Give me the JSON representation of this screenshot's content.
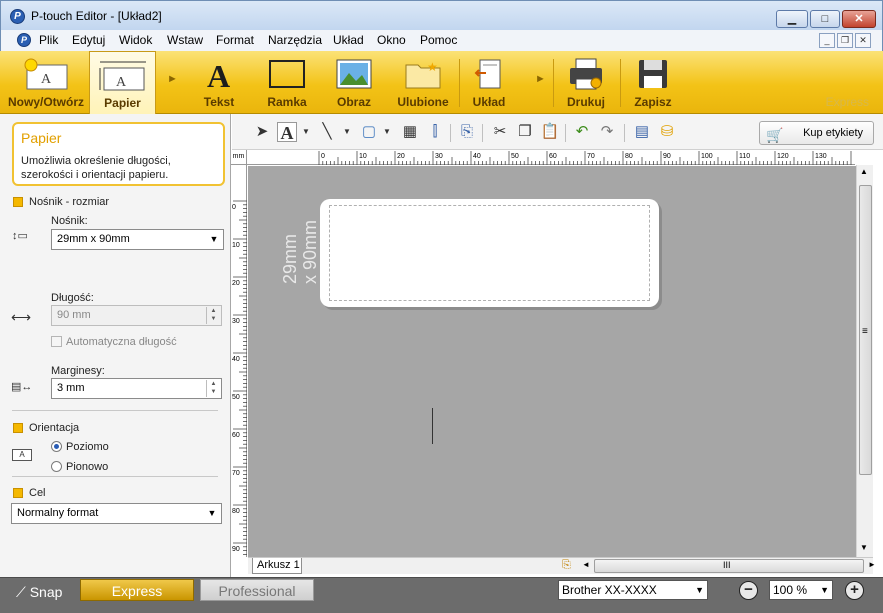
{
  "window": {
    "title": "P-touch Editor - [Układ2]",
    "min": "▁",
    "max": "□",
    "close": "✕"
  },
  "menu": [
    "Plik",
    "Edytuj",
    "Widok",
    "Wstaw",
    "Format",
    "Narzędzia",
    "Układ",
    "Okno",
    "Pomoc"
  ],
  "ribbon": {
    "buttons": {
      "new_open": "Nowy/Otwórz",
      "paper": "Papier",
      "text": "Tekst",
      "frame": "Ramka",
      "image": "Obraz",
      "favorites": "Ulubione",
      "layout": "Układ",
      "print": "Drukuj",
      "save": "Zapisz"
    },
    "mode_watermark": "Express"
  },
  "panel": {
    "title": "Papier",
    "description": "Umożliwia określenie długości, szerokości i orientacji papieru.",
    "media_section": "Nośnik - rozmiar",
    "media_label": "Nośnik:",
    "media_value": "29mm x 90mm",
    "length_label": "Długość:",
    "length_value": "90 mm",
    "auto_length": "Automatyczna długość",
    "margins_label": "Marginesy:",
    "margins_value": "3 mm",
    "orientation_section": "Orientacja",
    "landscape": "Poziomo",
    "portrait": "Pionowo",
    "target_section": "Cel",
    "target_value": "Normalny format"
  },
  "toolbar": {
    "buy_labels": "Kup etykiety"
  },
  "canvas": {
    "ruler_unit": "mm",
    "h_ticks": [
      "0",
      "10",
      "20",
      "30",
      "40",
      "50",
      "60",
      "70",
      "80",
      "90",
      "100",
      "110",
      "120",
      "130"
    ],
    "v_ticks": [
      "0",
      "10",
      "20",
      "30",
      "40",
      "50",
      "60",
      "70",
      "80",
      "90"
    ],
    "label_size_line1": "29mm",
    "label_size_line2": "x 90mm",
    "sheet_tab": "Arkusz 1",
    "hscroll_grip": "III",
    "vscroll_grip": "≡"
  },
  "status": {
    "snap": "Snap",
    "express": "Express",
    "professional": "Professional",
    "printer": "Brother XX-XXXX",
    "zoom": "100 %"
  },
  "colors": {
    "ribbon_accent": "#f3c317",
    "panel_title": "#e2a000",
    "canvas_bg": "#a6a6a6"
  }
}
